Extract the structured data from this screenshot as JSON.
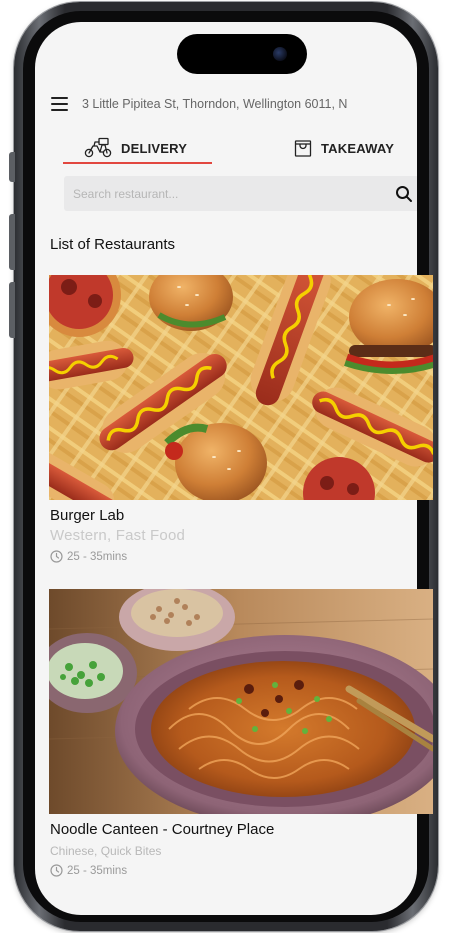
{
  "header": {
    "address": "3 Little Pipitea St, Thorndon, Wellington 6011, N"
  },
  "tabs": [
    {
      "label": "DELIVERY",
      "active": true
    },
    {
      "label": "TAKEAWAY",
      "active": false
    }
  ],
  "search": {
    "placeholder": "Search restaurant..."
  },
  "section_title": "List of Restaurants",
  "restaurants": [
    {
      "name": "Burger Lab",
      "cuisine": "Western, Fast Food",
      "time": "25 - 35mins",
      "image": "burgers-hotdogs-fries-photo"
    },
    {
      "name": "Noodle Canteen - Courtney Place",
      "cuisine": "Chinese, Quick Bites",
      "time": "25 - 35mins",
      "image": "noodles-bowl-photo"
    }
  ],
  "colors": {
    "accent": "#e2473f",
    "search_bg": "#e9e9ea",
    "screen_bg": "#f5f5f5"
  },
  "icons": [
    "menu-icon",
    "scooter-icon",
    "shopping-bag-icon",
    "search-icon",
    "clock-icon"
  ]
}
